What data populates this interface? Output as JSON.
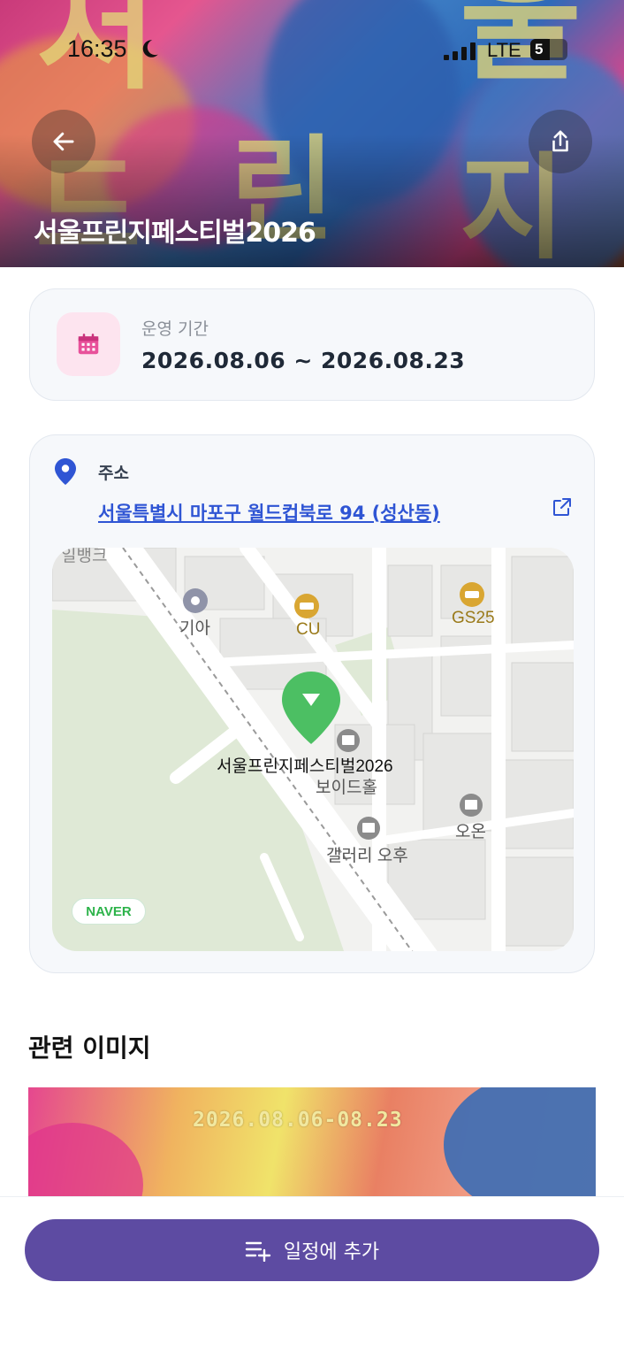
{
  "status_bar": {
    "time": "16:35",
    "network": "LTE",
    "battery": "5"
  },
  "hero": {
    "title": "서울프린지페스티벌2026",
    "bg_glyphs": [
      "처",
      "울",
      "드",
      "린",
      "지"
    ]
  },
  "period": {
    "label": "운영 기간",
    "value": "2026.08.06 ~ 2026.08.23"
  },
  "address": {
    "label": "주소",
    "value": "서울특별시 마포구 월드컵북로 94 (성산동)",
    "map": {
      "marker_label": "서울프린지페스티벌2026",
      "pois": [
        "기아",
        "CU",
        "GS25",
        "보이드홀",
        "오온",
        "갤러리 오후"
      ],
      "edge_label": "일뱅크",
      "provider": "NAVER"
    }
  },
  "related": {
    "title": "관련 이미지",
    "image_text": "2026.08.06-08.23"
  },
  "action": {
    "label": "일정에 추가"
  },
  "colors": {
    "accent": "#5d4ba2",
    "link": "#2f55d4",
    "marker": "#4cbf63"
  },
  "icons": [
    "back-arrow-icon",
    "share-icon",
    "calendar-icon",
    "location-pin-icon",
    "external-link-icon",
    "playlist-add-icon",
    "moon-icon"
  ]
}
